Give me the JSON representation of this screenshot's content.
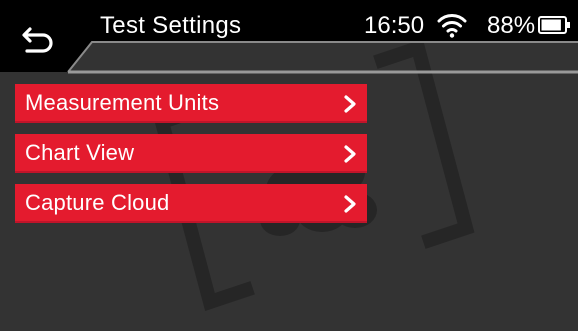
{
  "header": {
    "title": "Test Settings",
    "time": "16:50",
    "battery_percent": "88%",
    "battery_level": 0.88,
    "icons": {
      "back": "back-arrow-icon",
      "wifi": "wifi-icon",
      "battery": "battery-icon"
    }
  },
  "menu": {
    "items": [
      {
        "label": "Measurement Units",
        "icon": "chevron-right-icon"
      },
      {
        "label": "Chart View",
        "icon": "chevron-right-icon"
      },
      {
        "label": "Capture Cloud",
        "icon": "chevron-right-icon"
      }
    ]
  },
  "colors": {
    "accent": "#e41b2e",
    "background": "#333333",
    "header": "#000000"
  }
}
